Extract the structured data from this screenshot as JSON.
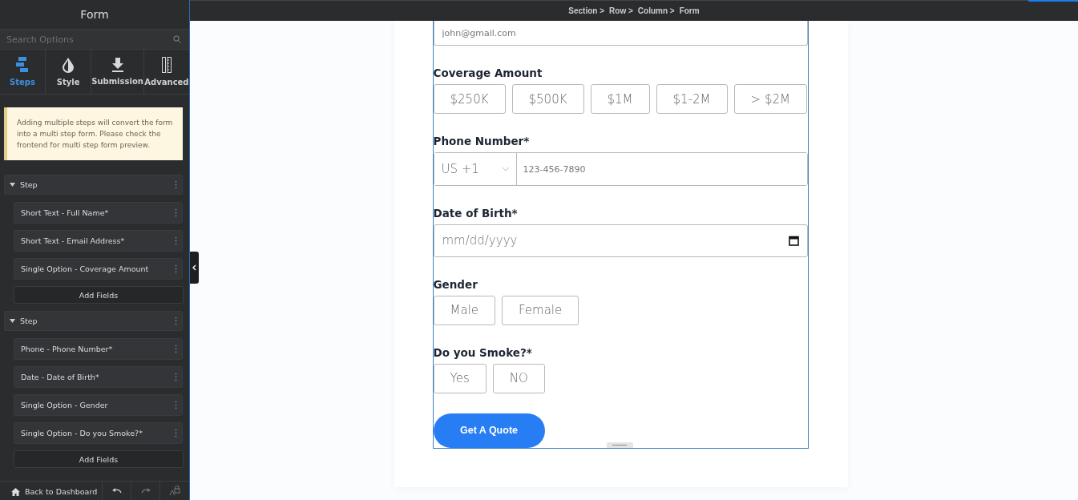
{
  "sidebar": {
    "title": "Form",
    "search": {
      "placeholder": "Search Options"
    },
    "tabs": [
      {
        "label": "Steps",
        "selected": true,
        "kind": "steps"
      },
      {
        "label": "Style",
        "selected": false,
        "kind": "style"
      },
      {
        "label": "Submission",
        "selected": false,
        "kind": "submission"
      },
      {
        "label": "Advanced",
        "selected": false,
        "kind": "advanced"
      }
    ],
    "notice": "Adding multiple steps will convert the form into a multi step form. Please check the frontend for multi step form preview.",
    "steps": [
      {
        "label": "Step",
        "expanded": true,
        "children": [
          {
            "label": "Short Text - Full Name*"
          },
          {
            "label": "Short Text - Email Address*"
          },
          {
            "label": "Single Option - Coverage Amount"
          }
        ],
        "add_button": "Add Fields"
      },
      {
        "label": "Step",
        "expanded": true,
        "children": [
          {
            "label": "Phone - Phone Number*"
          },
          {
            "label": "Date - Date of Birth*"
          },
          {
            "label": "Single Option - Gender"
          },
          {
            "label": "Single Option - Do you Smoke?*"
          }
        ],
        "add_button": "Add Fields"
      }
    ],
    "footer": {
      "back_link": "Back to Dashboard"
    }
  },
  "breadcrumb": [
    "Section >",
    "Row >",
    "Column >",
    "Form"
  ],
  "form": {
    "fields": [
      {
        "kind": "text",
        "placeholder": "john@gmail.com"
      },
      {
        "kind": "options",
        "label": "Coverage Amount",
        "options": [
          {
            "label": "$250K",
            "selected": false
          },
          {
            "label": "$500K",
            "selected": false
          },
          {
            "label": "$1M",
            "selected": false
          },
          {
            "label": "$1-2M",
            "selected": false
          },
          {
            "label": "> $2M",
            "selected": false
          }
        ]
      },
      {
        "kind": "phone",
        "label": "Phone Number*",
        "country": "US +1",
        "placeholder": "123-456-7890"
      },
      {
        "kind": "date",
        "label": "Date of Birth*",
        "placeholder": "mm/dd/yyyy"
      },
      {
        "kind": "options",
        "label": "Gender",
        "options": [
          {
            "label": "Male",
            "selected": false
          },
          {
            "label": "Female",
            "selected": false
          }
        ]
      },
      {
        "kind": "options",
        "label": "Do you Smoke?*",
        "options": [
          {
            "label": "Yes",
            "selected": false
          },
          {
            "label": "NO",
            "selected": false
          }
        ]
      }
    ],
    "submit": "Get A Quote"
  }
}
